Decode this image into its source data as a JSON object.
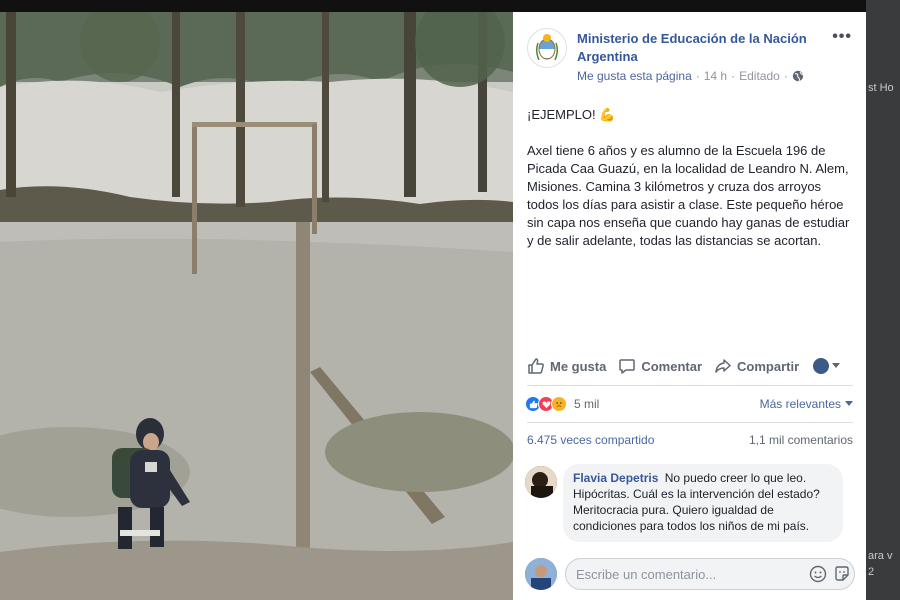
{
  "background": {
    "right_texts": [
      "st Ho",
      "ara v",
      "2"
    ]
  },
  "post": {
    "page_name": "Ministerio de Educación de la Nación Argentina",
    "like_page": "Me gusta esta página",
    "time": "14 h",
    "edited": "Editado",
    "separator": "·",
    "more": "•••",
    "headline": "¡EJEMPLO! 💪",
    "body": "Axel tiene 6 años y es alumno de la Escuela 196 de Picada Caa Guazú, en la localidad de Leandro N. Alem, Misiones. Camina 3 kilómetros y cruza dos arroyos todos los días para asistir a clase. Este pequeño héroe sin capa nos enseña que cuando hay ganas de estudiar y de salir adelante, todas las distancias se acortan."
  },
  "actions": {
    "like": "Me gusta",
    "comment": "Comentar",
    "share": "Compartir"
  },
  "reactions": {
    "count": "5 mil",
    "sort": "Más relevantes",
    "icons": [
      "like-icon",
      "love-icon",
      "sad-icon"
    ]
  },
  "stats": {
    "shares": "6.475 veces compartido",
    "comments": "1,1 mil comentarios"
  },
  "comment": {
    "author": "Flavia Depetris",
    "text": "No puedo creer lo que leo. Hipócritas. Cuál es la intervención del estado? Meritocracia pura. Quiero igualdad de condiciones para todos los niños de mi país."
  },
  "composer": {
    "placeholder": "Escribe un comentario..."
  },
  "colors": {
    "link": "#365899",
    "like_blue": "#2078f4",
    "love_red": "#f33e58",
    "sad_yellow": "#f7b125"
  }
}
